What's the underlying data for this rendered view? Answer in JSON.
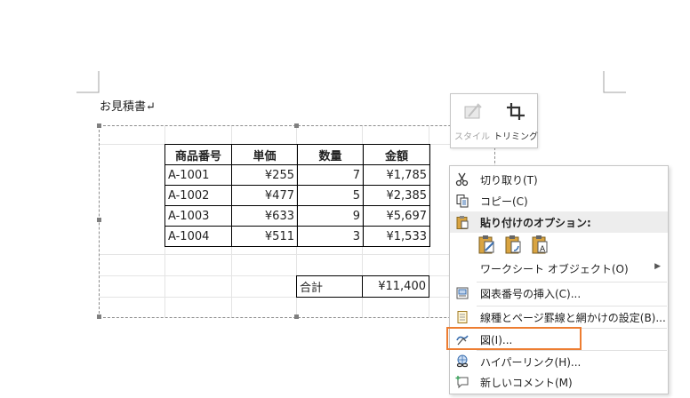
{
  "document": {
    "title": "お見積書↵"
  },
  "table": {
    "headers": [
      "商品番号",
      "単価",
      "数量",
      "金額"
    ],
    "rows": [
      [
        "A-1001",
        "¥255",
        "7",
        "¥1,785"
      ],
      [
        "A-1002",
        "¥477",
        "5",
        "¥2,385"
      ],
      [
        "A-1003",
        "¥633",
        "9",
        "¥5,697"
      ],
      [
        "A-1004",
        "¥511",
        "3",
        "¥1,533"
      ]
    ],
    "total_label": "合計",
    "total_value": "¥11,400"
  },
  "mini_toolbar": {
    "style_label": "スタイル",
    "crop_label": "トリミング"
  },
  "context_menu": {
    "cut": "切り取り(T)",
    "copy": "コピー(C)",
    "paste_options": "貼り付けのオプション:",
    "worksheet_object": "ワークシート オブジェクト(O)",
    "insert_caption": "図表番号の挿入(C)...",
    "borders_shading": "線種とページ罫線と網かけの設定(B)...",
    "picture": "図(I)...",
    "hyperlink": "ハイパーリンク(H)...",
    "new_comment": "新しいコメント(M)"
  },
  "colors": {
    "highlight": "#ed7d31",
    "icon_blue": "#3a6fb0",
    "icon_orange": "#e0a030"
  },
  "icons": [
    "scissors-icon",
    "copy-icon",
    "paste-icon",
    "paste-keep-source-icon",
    "paste-picture-icon",
    "paste-text-icon",
    "caption-icon",
    "borders-icon",
    "picture-icon",
    "hyperlink-icon",
    "comment-icon",
    "style-icon",
    "crop-icon",
    "submenu-arrow-icon"
  ]
}
